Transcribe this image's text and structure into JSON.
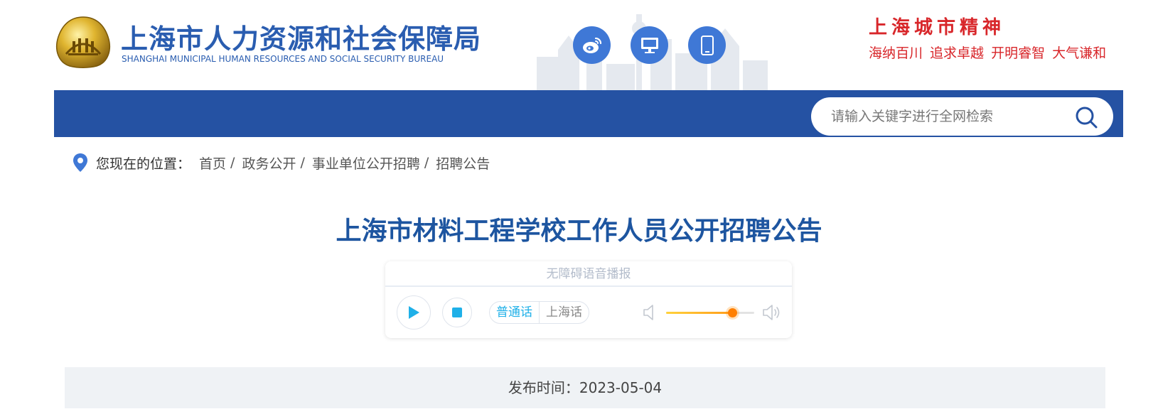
{
  "header": {
    "title": "上海市人力资源和社会保障局",
    "subtitle": "SHANGHAI MUNICIPAL HUMAN RESOURCES AND SOCIAL SECURITY BUREAU",
    "icons": [
      "weibo-icon",
      "desktop-icon",
      "mobile-icon"
    ],
    "spirit": {
      "title": "上海城市精神",
      "line": "海纳百川 追求卓越 开明睿智 大气谦和"
    }
  },
  "search": {
    "placeholder": "请输入关键字进行全网检索"
  },
  "breadcrumb": {
    "label": "您现在的位置：",
    "items": [
      "首页",
      "政务公开",
      "事业单位公开招聘",
      "招聘公告"
    ],
    "separator": "/"
  },
  "article": {
    "title": "上海市材料工程学校工作人员公开招聘公告"
  },
  "player": {
    "header": "无障碍语音播报",
    "languages": [
      "普通话",
      "上海话"
    ],
    "selected_language": "普通话",
    "volume": 0.75
  },
  "meta": {
    "publish_label": "发布时间：",
    "publish_date": "2023-05-04"
  },
  "colors": {
    "brand_blue": "#2552a3",
    "title_blue": "#1d55a0",
    "spirit_red": "#d8262a",
    "accent_cyan": "#1fb0e8",
    "volume_orange": "#ff7f00"
  }
}
